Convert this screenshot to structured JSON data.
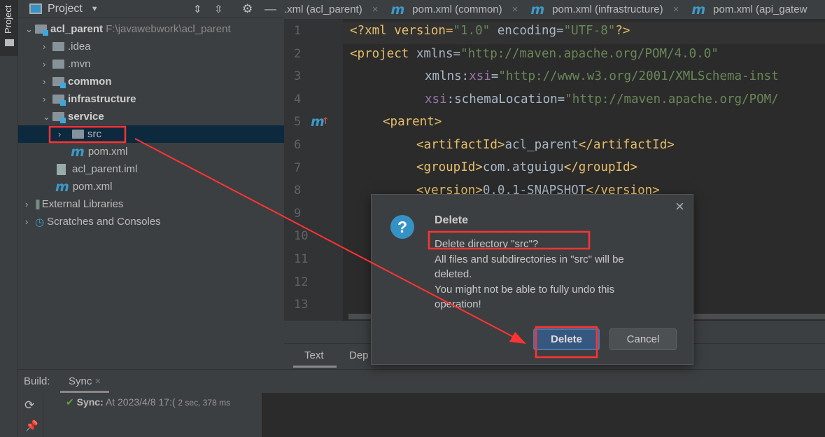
{
  "side_strip": {
    "label": "Project"
  },
  "project": {
    "title": "Project",
    "root": {
      "name": "acl_parent",
      "path": "F:\\javawebwork\\acl_parent"
    },
    "items": [
      {
        "label": ".idea"
      },
      {
        "label": ".mvn"
      },
      {
        "label": "common"
      },
      {
        "label": "infrastructure"
      },
      {
        "label": "service"
      },
      {
        "label": "src"
      },
      {
        "label": "pom.xml"
      },
      {
        "label": "acl_parent.iml"
      },
      {
        "label": "pom.xml"
      },
      {
        "label": "External Libraries"
      },
      {
        "label": "Scratches and Consoles"
      }
    ]
  },
  "tabs": [
    {
      "label": ".xml (acl_parent)"
    },
    {
      "label": "pom.xml (common)"
    },
    {
      "label": "pom.xml (infrastructure)"
    },
    {
      "label": "pom.xml (api_gatew"
    }
  ],
  "editor": {
    "line_numbers": [
      "1",
      "2",
      "3",
      "4",
      "5",
      "6",
      "7",
      "8",
      "9",
      "10",
      "11",
      "12",
      "13"
    ],
    "lines": [
      [
        "<?xml version=",
        "\"1.0\"",
        " encoding=",
        "\"UTF-8\"",
        "?>"
      ],
      [
        "<project",
        " xmlns=",
        "\"http://maven.apache.org/POM/4.0.0\""
      ],
      [
        "xmlns:",
        "xsi",
        "=",
        "\"http://www.w3.org/2001/XMLSchema-inst"
      ],
      [
        "xsi",
        ":schemaLocation=",
        "\"http://maven.apache.org/POM/"
      ],
      [
        "<parent>"
      ],
      [
        "<artifactId>",
        "acl_parent",
        "</artifactId>"
      ],
      [
        "<groupId>",
        "com.atguigu",
        "</groupId>"
      ],
      [
        "<version>",
        "0.0.1-SNAPSHOT",
        "</version>"
      ]
    ],
    "bottom_tabs": [
      "Text",
      "Dep"
    ]
  },
  "dialog": {
    "title": "Delete",
    "question": "Delete directory \"src\"?",
    "line1": "All files and subdirectories in \"src\" will be",
    "line2": "deleted.",
    "line3": "You might not be able to fully undo this",
    "line4": "operation!",
    "delete_label": "Delete",
    "cancel_label": "Cancel",
    "close": "×",
    "accent": "#365880"
  },
  "build": {
    "label": "Build:",
    "tab": "Sync",
    "status_bold": "Sync:",
    "status_text": "At 2023/4/8 17:(",
    "duration": "2 sec, 378 ms"
  },
  "annotation_color": "#ff3333"
}
